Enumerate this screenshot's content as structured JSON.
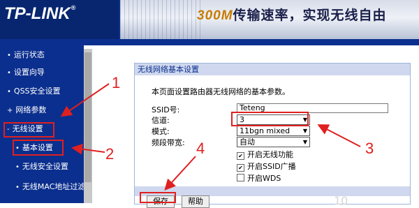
{
  "header": {
    "logo": "TP-LINK",
    "logo_reg": "®",
    "slogan_prefix": "300M",
    "slogan_main": "传输速率，实现无线自由"
  },
  "sidebar": {
    "items": [
      {
        "label": "运行状态"
      },
      {
        "label": "设置向导"
      },
      {
        "label": "QSS安全设置"
      },
      {
        "label": "网络参数"
      },
      {
        "label": "无线设置"
      },
      {
        "label": "基本设置"
      },
      {
        "label": "无线安全设置"
      },
      {
        "label": "无线MAC地址过滤"
      }
    ]
  },
  "panel": {
    "title": "无线网络基本设置",
    "description": "本页面设置路由器无线网络的基本参数。",
    "ssid_label": "SSID号:",
    "ssid_value": "Teteng",
    "channel_label": "信道:",
    "channel_value": "3",
    "mode_label": "模式:",
    "mode_value": "11bgn mixed",
    "bandwidth_label": "频段带宽:",
    "bandwidth_value": "自动",
    "enable_wireless": {
      "label": "开启无线功能",
      "checked": true
    },
    "enable_ssid_broadcast": {
      "label": "开启SSID广播",
      "checked": true
    },
    "enable_wds": {
      "label": "开启WDS",
      "checked": false
    },
    "save_label": "保存",
    "help_label": "帮助"
  },
  "annotations": {
    "n1": "1",
    "n2": "2",
    "n3": "3",
    "n4": "4",
    "color": "#e02020"
  },
  "watermark": "10"
}
